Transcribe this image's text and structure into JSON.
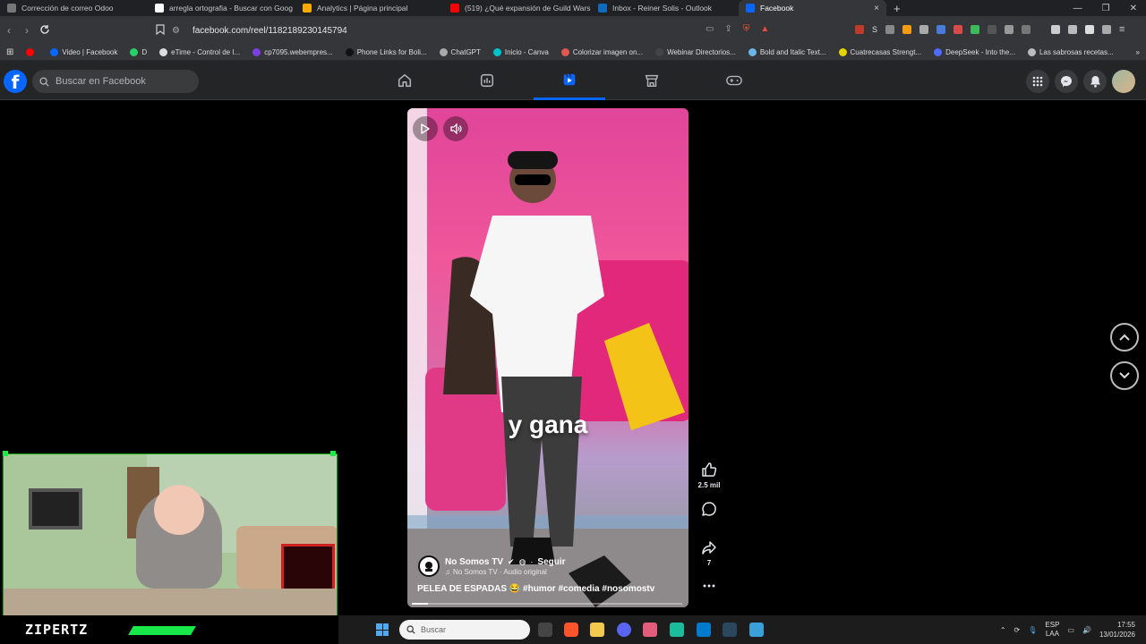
{
  "browser": {
    "tabs": [
      {
        "title": "Corrección de correo Odoo",
        "color": "#777777"
      },
      {
        "title": "arregla ortografia - Buscar con Goog",
        "color": "#ffffff"
      },
      {
        "title": "Analytics | Página principal",
        "color": "#f9ab00"
      },
      {
        "title": "(519) ¿Qué expansión de Guild Wars",
        "color": "#ff0000"
      },
      {
        "title": "Inbox - Reiner Solis - Outlook",
        "color": "#0f6cbd"
      },
      {
        "title": "Facebook",
        "color": "#0866ff",
        "active": true
      }
    ],
    "new_tab": "+",
    "close": "×",
    "url": "facebook.com/reel/1182189230145794",
    "bookmarks": [
      {
        "label": "",
        "color": "#ff0000"
      },
      {
        "label": "Video | Facebook",
        "color": "#0866ff"
      },
      {
        "label": "D",
        "color": "#25d366"
      },
      {
        "label": "eTime - Control de I...",
        "color": "#dddddd"
      },
      {
        "label": "cp7095.webempres...",
        "color": "#7b3fe4"
      },
      {
        "label": "Phone Links for Boli...",
        "color": "#111111"
      },
      {
        "label": "ChatGPT",
        "color": "#aaaaaa"
      },
      {
        "label": "Inicio - Canva",
        "color": "#00c4cc"
      },
      {
        "label": "Colorizar imagen on...",
        "color": "#e0584f"
      },
      {
        "label": "Webinar Directorios...",
        "color": "#444444"
      },
      {
        "label": "Bold and Italic Text...",
        "color": "#6ab4e8"
      },
      {
        "label": "Cuatrecasas Strengt...",
        "color": "#e6d200"
      },
      {
        "label": "DeepSeek - Into the...",
        "color": "#4d6bfe"
      },
      {
        "label": "Las sabrosas recetas...",
        "color": "#bbbbbb"
      }
    ]
  },
  "facebook": {
    "logo": "f",
    "search_placeholder": "Buscar en Facebook",
    "nav": [
      "home-icon",
      "video-feed-icon",
      "reels-icon",
      "marketplace-icon",
      "gaming-icon"
    ],
    "active_nav": "reels-icon",
    "accent": "#0866ff"
  },
  "reel": {
    "caption": "y gana",
    "author": "No Somos TV",
    "follow": "Seguir",
    "audio": "No Somos TV · Audio original",
    "description": "PELEA DE ESPADAS 😂 #humor #comedia #nosomostv",
    "likes": "2.5 mil",
    "shares": "7",
    "progress": 0.06
  },
  "webcam": {
    "streamer": "ZIPERTZ",
    "accent": "#18e84a"
  },
  "taskbar": {
    "search": "Buscar",
    "lang": "ESP",
    "lang_sub": "LAA",
    "time": "17:55",
    "date": "13/01/2026"
  }
}
